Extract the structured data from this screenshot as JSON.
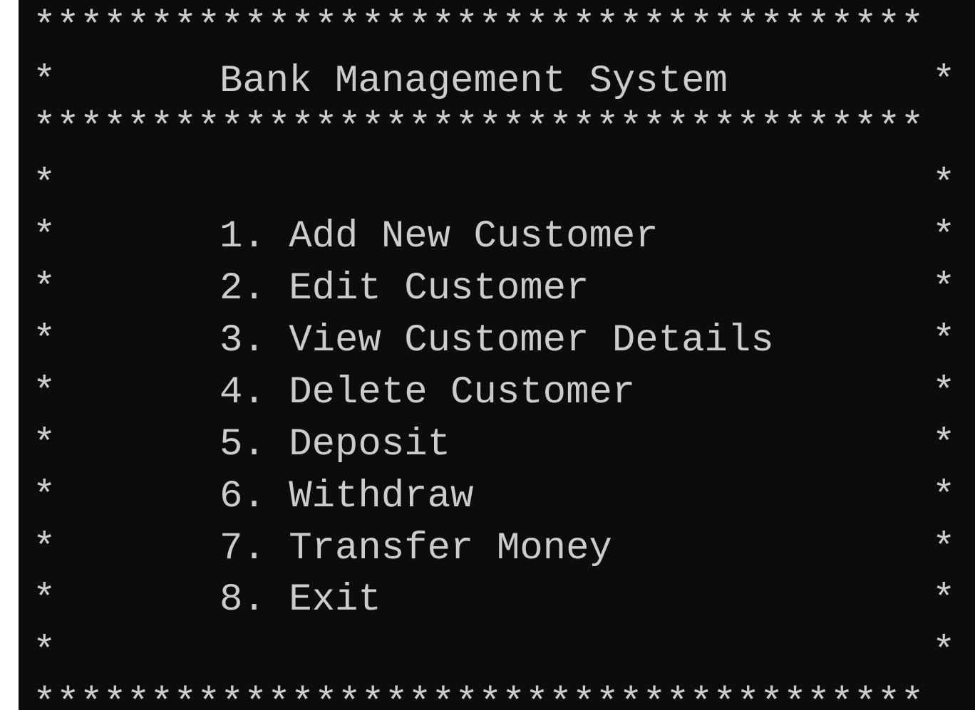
{
  "console": {
    "border_line": "**************************************",
    "star": "*",
    "title": "Bank Management System",
    "menu": [
      {
        "number": "1.",
        "label": "Add New Customer"
      },
      {
        "number": "2.",
        "label": "Edit Customer"
      },
      {
        "number": "3.",
        "label": "View Customer Details"
      },
      {
        "number": "4.",
        "label": "Delete Customer"
      },
      {
        "number": "5.",
        "label": "Deposit"
      },
      {
        "number": "6.",
        "label": "Withdraw"
      },
      {
        "number": "7.",
        "label": "Transfer Money"
      },
      {
        "number": "8.",
        "label": "Exit"
      }
    ],
    "colors": {
      "background": "#0c0c0c",
      "text": "#cccccc"
    }
  }
}
